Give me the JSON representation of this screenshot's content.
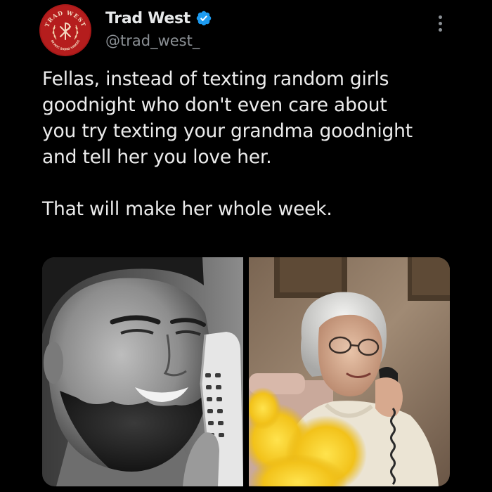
{
  "author": {
    "name": "Trad West",
    "handle": "@trad_west_",
    "verified": true,
    "avatar_text_top": "TRAD WEST",
    "avatar_text_bottom": "IN HOC SIGNO VINCES",
    "avatar_color": "#b51d1d"
  },
  "tweet": {
    "lines": [
      "Fellas, instead of texting random girls",
      "goodnight who don't even care about",
      "you try texting your grandma goodnight",
      "and tell her you love her."
    ],
    "paragraph2": "That will make her whole week."
  },
  "media": {
    "left_image": "gigachad-on-phone",
    "right_image": "grandma-on-phone"
  },
  "colors": {
    "background": "#000000",
    "text": "#e7e9ea",
    "secondary": "#8b9095",
    "verified_blue": "#1d9bf0"
  },
  "icons": {
    "verified": "verified-badge-icon",
    "more": "more-options-icon"
  }
}
